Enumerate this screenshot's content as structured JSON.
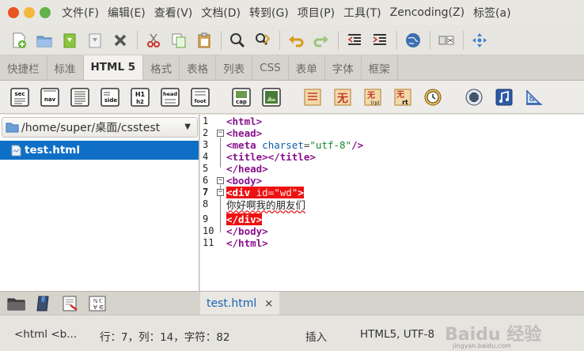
{
  "window": {
    "close_color": "#e95420",
    "min_color": "#f5b83d",
    "max_color": "#62b24a"
  },
  "menu": [
    "文件(F)",
    "编辑(E)",
    "查看(V)",
    "文档(D)",
    "转到(G)",
    "项目(P)",
    "工具(T)",
    "Zencoding(Z)",
    "标签(a)"
  ],
  "toolbar": {
    "icons": [
      "new-file-icon",
      "open-folder-icon",
      "save-icon",
      "save-as-icon",
      "close-icon",
      "cut-icon",
      "copy-icon",
      "paste-icon",
      "find-icon",
      "replace-icon",
      "undo-icon",
      "redo-icon",
      "unindent-icon",
      "indent-icon",
      "preview-globe-icon",
      "fullscreen-icon",
      "settings-icon"
    ]
  },
  "tabs": [
    "快捷栏",
    "标准",
    "HTML 5",
    "格式",
    "表格",
    "列表",
    "CSS",
    "表单",
    "字体",
    "框架"
  ],
  "active_tab": "HTML 5",
  "html5_icons": [
    {
      "name": "section-icon",
      "label": "sec"
    },
    {
      "name": "nav-icon",
      "label": "nav"
    },
    {
      "name": "article-icon",
      "label": ""
    },
    {
      "name": "aside-icon",
      "label": "side"
    },
    {
      "name": "hgroup-icon",
      "label": "H1"
    },
    {
      "name": "header-icon",
      "label": "head"
    },
    {
      "name": "footer-icon",
      "label": "foot"
    },
    {
      "name": "figcaption-icon",
      "label": "cap"
    },
    {
      "name": "figure-icon",
      "label": ""
    },
    {
      "name": "ruby-icon",
      "label": ""
    },
    {
      "name": "rp-icon",
      "label": "无"
    },
    {
      "name": "rp2-icon",
      "label": "rp"
    },
    {
      "name": "rt-icon",
      "label": "rt"
    },
    {
      "name": "time-icon",
      "label": ""
    },
    {
      "name": "audio-video-icon",
      "label": ""
    },
    {
      "name": "music-icon",
      "label": ""
    },
    {
      "name": "canvas-icon",
      "label": ""
    }
  ],
  "sidebar": {
    "path": "/home/super/桌面/csstest",
    "files": [
      "test.html"
    ]
  },
  "editor": {
    "line_numbers": [
      "1",
      "2",
      "3",
      "4",
      "5",
      "6",
      "7",
      "8",
      "9",
      "10",
      "11"
    ],
    "current_line": "7",
    "chinese_text": "你好啊我的朋友们"
  },
  "document_tab": {
    "label": "test.html",
    "close": "×"
  },
  "status": {
    "context": "<html <b...",
    "position": "行：7，列：14，字符：82",
    "mode": "插入",
    "encoding": "HTML5, UTF-8"
  },
  "watermark": {
    "text": "Baidu 经验",
    "url": "jingyan.baidu.com"
  }
}
